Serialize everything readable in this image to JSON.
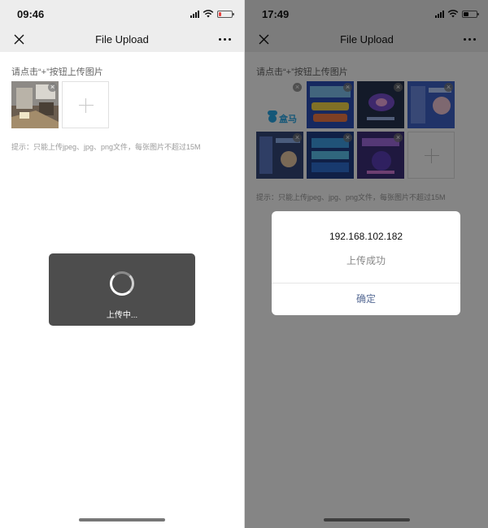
{
  "left_screen": {
    "status": {
      "time": "09:46",
      "battery_color": "#e64340"
    },
    "nav": {
      "title": "File Upload"
    },
    "upload": {
      "instruction": "请点击“+”按钮上传图片",
      "tip": "提示：只能上传jpeg、jpg、png文件，每张图片不超过15M",
      "remove_icon": "×",
      "images": [
        {
          "thumb": "photo-thumbnail"
        }
      ]
    },
    "toast": {
      "text": "上传中..."
    }
  },
  "right_screen": {
    "status": {
      "time": "17:49",
      "battery_color": "#111111"
    },
    "nav": {
      "title": "File Upload"
    },
    "upload": {
      "instruction": "请点击“+”按钮上传图片",
      "tip": "提示：只能上传jpeg、jpg、png文件，每张图片不超过15M",
      "remove_icon": "×",
      "images": [
        {
          "thumb": "logo-thumbnail",
          "logo_text": "盒马"
        },
        {
          "thumb": "screenshot-thumbnail"
        },
        {
          "thumb": "screenshot-thumbnail"
        },
        {
          "thumb": "screenshot-thumbnail"
        },
        {
          "thumb": "screenshot-thumbnail"
        },
        {
          "thumb": "screenshot-thumbnail"
        },
        {
          "thumb": "screenshot-thumbnail"
        }
      ]
    },
    "dialog": {
      "title": "192.168.102.182",
      "message": "上传成功",
      "confirm_label": "确定"
    }
  },
  "colors": {
    "link_blue": "#576b95",
    "nav_bg": "#ededed"
  }
}
